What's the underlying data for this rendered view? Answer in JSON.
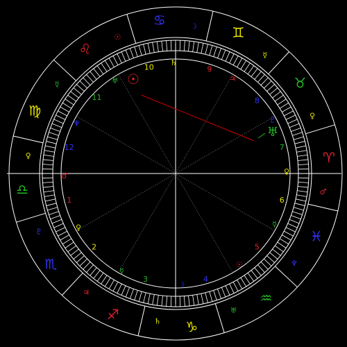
{
  "colors": {
    "background": "#000000",
    "ring": "#ffffff",
    "red": "#e0202a",
    "green": "#22bb22",
    "yellow": "#e6e600",
    "blue": "#3333ff",
    "aspect_line": "#cc0000"
  },
  "signs": [
    {
      "name": "cancer",
      "glyph": "♋",
      "color": "#3333ff"
    },
    {
      "name": "gemini",
      "glyph": "♊",
      "color": "#e6e600"
    },
    {
      "name": "taurus",
      "glyph": "♉",
      "color": "#22bb22"
    },
    {
      "name": "aries",
      "glyph": "♈",
      "color": "#e0202a"
    },
    {
      "name": "pisces",
      "glyph": "♓",
      "color": "#3333ff"
    },
    {
      "name": "aquarius",
      "glyph": "♒",
      "color": "#22bb22"
    },
    {
      "name": "capricorn",
      "glyph": "♑",
      "color": "#e6e600"
    },
    {
      "name": "sagittarius",
      "glyph": "♐",
      "color": "#e0202a"
    },
    {
      "name": "scorpio",
      "glyph": "♏",
      "color": "#3333ff"
    },
    {
      "name": "libra",
      "glyph": "♎",
      "color": "#22bb22"
    },
    {
      "name": "virgo",
      "glyph": "♍",
      "color": "#e6e600"
    },
    {
      "name": "leo",
      "glyph": "♌",
      "color": "#e0202a"
    }
  ],
  "ruler_glyphs": [
    {
      "name": "cancer-ruler",
      "glyph": "☽",
      "color": "#3333ff"
    },
    {
      "name": "gemini-ruler",
      "glyph": "☿",
      "color": "#e6e600"
    },
    {
      "name": "taurus-ruler",
      "glyph": "♀",
      "color": "#e6e600"
    },
    {
      "name": "aries-ruler",
      "glyph": "♂",
      "color": "#e0202a"
    },
    {
      "name": "pisces-ruler",
      "glyph": "♆",
      "color": "#3333ff"
    },
    {
      "name": "aquarius-ruler",
      "glyph": "♅",
      "color": "#22bb22"
    },
    {
      "name": "capricorn-ruler",
      "glyph": "♄",
      "color": "#e6e600"
    },
    {
      "name": "sagittarius-ruler",
      "glyph": "♃",
      "color": "#e0202a"
    },
    {
      "name": "scorpio-ruler",
      "glyph": "♇",
      "color": "#3333ff"
    },
    {
      "name": "libra-ruler",
      "glyph": "♀",
      "color": "#e6e600"
    },
    {
      "name": "virgo-ruler",
      "glyph": "☿",
      "color": "#22bb22"
    },
    {
      "name": "leo-ruler",
      "glyph": "☉",
      "color": "#e0202a"
    }
  ],
  "houses": [
    {
      "number": "1",
      "color": "#e0202a"
    },
    {
      "number": "2",
      "color": "#e6e600"
    },
    {
      "number": "3",
      "color": "#22bb22"
    },
    {
      "number": "4",
      "color": "#3333ff"
    },
    {
      "number": "5",
      "color": "#e0202a"
    },
    {
      "number": "6",
      "color": "#e6e600"
    },
    {
      "number": "7",
      "color": "#22bb22"
    },
    {
      "number": "8",
      "color": "#3333ff"
    },
    {
      "number": "9",
      "color": "#e0202a"
    },
    {
      "number": "10",
      "color": "#e6e600"
    },
    {
      "number": "11",
      "color": "#22bb22"
    },
    {
      "number": "12",
      "color": "#3333ff"
    }
  ],
  "house_rulers": [
    {
      "name": "house-1-ruler",
      "glyph": "♂",
      "color": "#e0202a"
    },
    {
      "name": "house-2-ruler",
      "glyph": "♀",
      "color": "#e6e600"
    },
    {
      "name": "house-3-ruler",
      "glyph": "☿",
      "color": "#22bb22"
    },
    {
      "name": "house-4-ruler",
      "glyph": "☽",
      "color": "#3333ff"
    },
    {
      "name": "house-5-ruler",
      "glyph": "☉",
      "color": "#e0202a"
    },
    {
      "name": "house-6-ruler",
      "glyph": "☿",
      "color": "#22bb22"
    },
    {
      "name": "house-7-ruler",
      "glyph": "♀",
      "color": "#e6e600"
    },
    {
      "name": "house-8-ruler",
      "glyph": "♇",
      "color": "#3333ff"
    },
    {
      "name": "house-9-ruler",
      "glyph": "♃",
      "color": "#e0202a"
    },
    {
      "name": "house-10-ruler",
      "glyph": "♄",
      "color": "#e6e600"
    },
    {
      "name": "house-11-ruler",
      "glyph": "♅",
      "color": "#22bb22"
    },
    {
      "name": "house-12-ruler",
      "glyph": "♆",
      "color": "#3333ff"
    }
  ],
  "planets": [
    {
      "name": "sun",
      "glyph": "☉",
      "color": "#e0202a"
    },
    {
      "name": "uranus",
      "glyph": "♅",
      "color": "#22bb22"
    }
  ]
}
